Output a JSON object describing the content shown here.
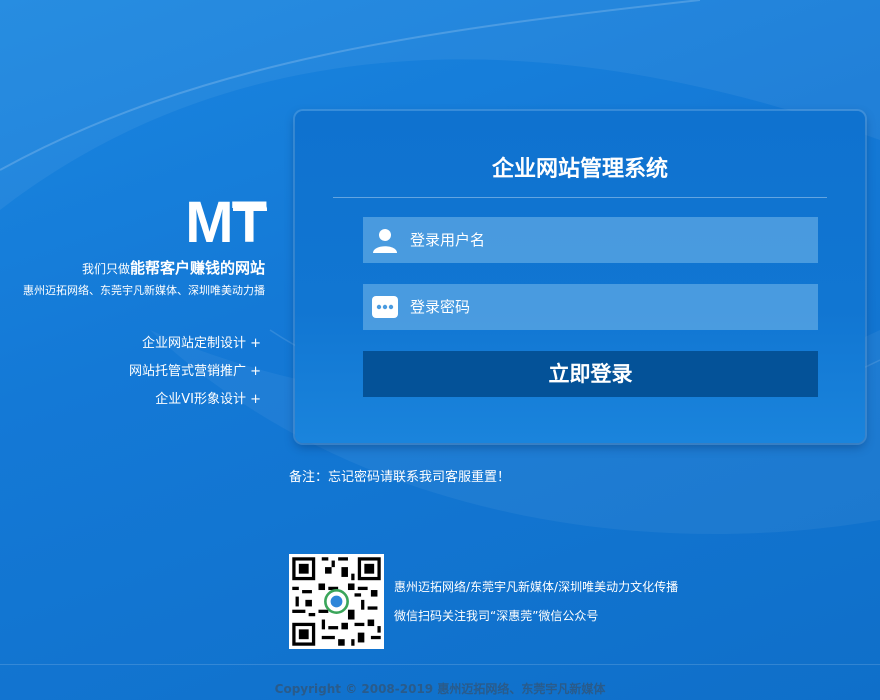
{
  "brand": {
    "logo": "MT",
    "slogan_prefix": "我们只做",
    "slogan_main": "能帮客户赚钱的网站",
    "sub": "惠州迈拓网络、东莞宇凡新媒体、深圳唯美动力播"
  },
  "services": [
    "企业网站定制设计 +",
    "网站托管式营销推广 +",
    "企业VI形象设计 +"
  ],
  "login": {
    "title": "企业网站管理系统",
    "username_placeholder": "登录用户名",
    "password_placeholder": "登录密码",
    "submit_label": "立即登录"
  },
  "note": "备注：忘记密码请联系我司客服重置！",
  "footer": {
    "info_line1": "惠州迈拓网络/东莞宇凡新媒体/深圳唯美动力文化传播",
    "info_line2": "微信扫码关注我司“深惠莞”微信公众号",
    "copyright": "Copyright © 2008-2019 惠州迈拓网络、东莞宇凡新媒体"
  },
  "colors": {
    "background": "#1479d6",
    "panel": "#1176d2",
    "button": "#045298"
  },
  "icons": {
    "username": "user-icon",
    "password": "password-dots-icon"
  }
}
